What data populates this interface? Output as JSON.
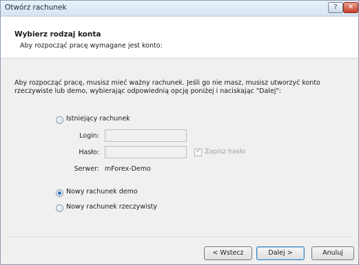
{
  "window": {
    "title": "Otwórz rachunek",
    "help_glyph": "?",
    "close_glyph": "✕"
  },
  "header": {
    "title": "Wybierz rodzaj konta",
    "subtitle": "Aby rozpocząć pracę wymagane jest konto:"
  },
  "intro": "Aby rozpocząć pracę, musisz mieć ważny rachunek. Jeśli go nie masz, musisz utworzyć konto rzeczywiste lub demo, wybierając odpowiednią opcję poniżej i naciskając \"Dalej\":",
  "options": {
    "existing": {
      "label": "Istniejący rachunek",
      "selected": false
    },
    "demo": {
      "label": "Nowy rachunek demo",
      "selected": true
    },
    "real": {
      "label": "Nowy rachunek rzeczywisty",
      "selected": false
    }
  },
  "fields": {
    "login_label": "Login:",
    "login_value": "",
    "password_label": "Hasło:",
    "password_value": "",
    "save_password_label": "Zapisz hasło",
    "save_password_checked": true,
    "server_label": "Serwer:",
    "server_value": "mForex-Demo"
  },
  "buttons": {
    "back": "< Wstecz",
    "next": "Dalej >",
    "cancel": "Anuluj"
  }
}
